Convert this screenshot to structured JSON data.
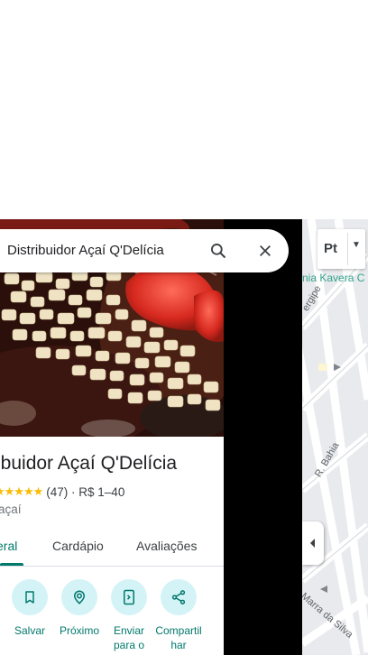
{
  "search": {
    "query": "Distribuidor Açaí Q'Delícia"
  },
  "place": {
    "title": "ibuidor Açaí Q'Delícia",
    "stars": "★★★★★",
    "rating_detail": "(47) · R$ 1–40",
    "category": "açaí"
  },
  "tabs": [
    {
      "label": "eral",
      "active": true
    },
    {
      "label": "Cardápio"
    },
    {
      "label": "Avaliações"
    }
  ],
  "actions": [
    {
      "label": "Salvar",
      "icon": "bookmark-icon"
    },
    {
      "label": "Próximo",
      "icon": "nearby-icon"
    },
    {
      "label": "Enviar para o",
      "icon": "send-to-phone-icon"
    },
    {
      "label": "Compartilhar",
      "icon": "share-icon"
    }
  ],
  "map": {
    "layer_label": "Pt",
    "streets": [
      "nia Kavera C",
      "ergipe",
      "R. Bahia",
      "Marra da Silva"
    ]
  },
  "colors": {
    "accent": "#00796b",
    "action_bg": "#d4f3f7",
    "star": "#fbbc04"
  }
}
